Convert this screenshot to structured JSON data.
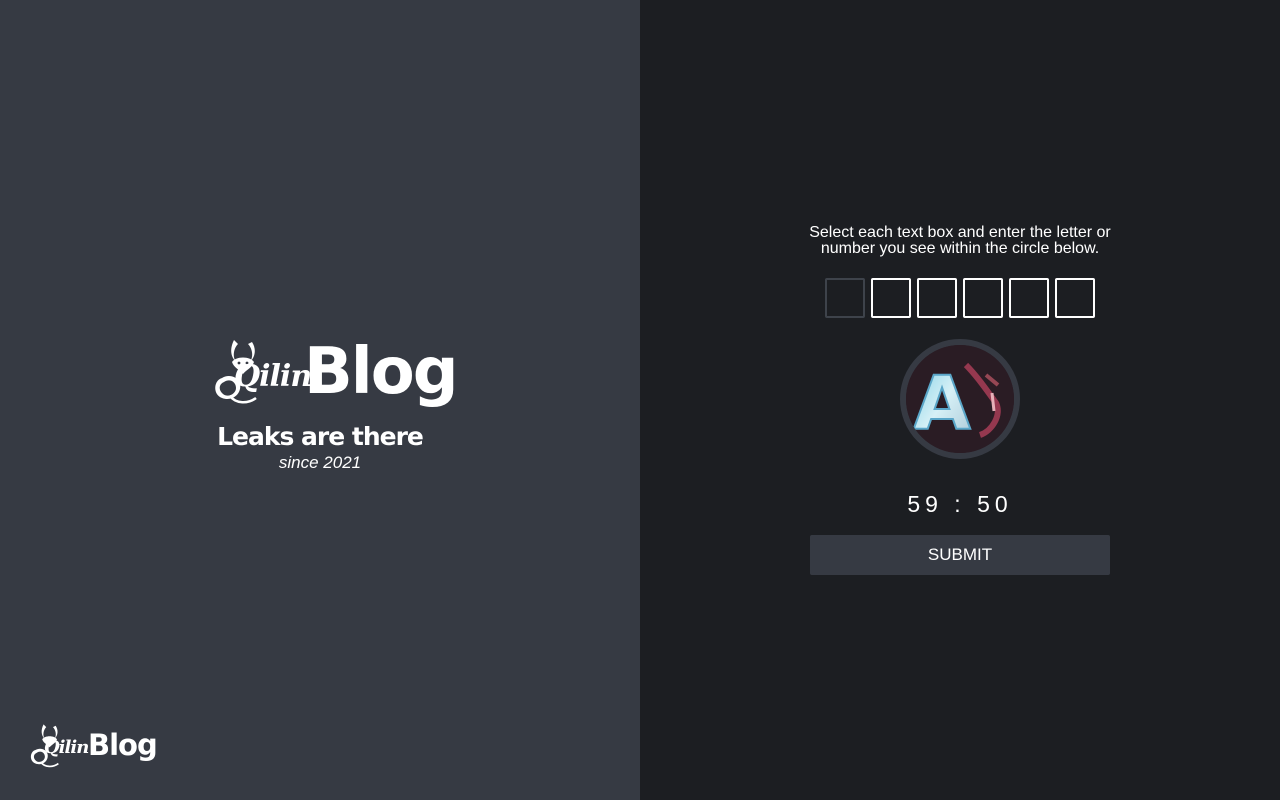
{
  "brand": {
    "logo_script": "Qilin",
    "title": "Blog",
    "tagline": "Leaks are there",
    "since": "since 2021"
  },
  "footer": {
    "logo_script": "Qilin",
    "title": "Blog"
  },
  "captcha": {
    "instructions": "Select each text box and enter the letter or number you see within the circle below.",
    "boxes": [
      "",
      "",
      "",
      "",
      "",
      ""
    ],
    "focused_index": 0,
    "visible_glyph": "A",
    "timer": "59 : 50",
    "submit_label": "SUBMIT"
  },
  "colors": {
    "left_bg": "#363a43",
    "right_bg": "#1c1e22",
    "button_bg": "#363a43",
    "text": "#ffffff"
  },
  "icons": {
    "brand_logo": "qilin-dragon-logo-icon"
  }
}
